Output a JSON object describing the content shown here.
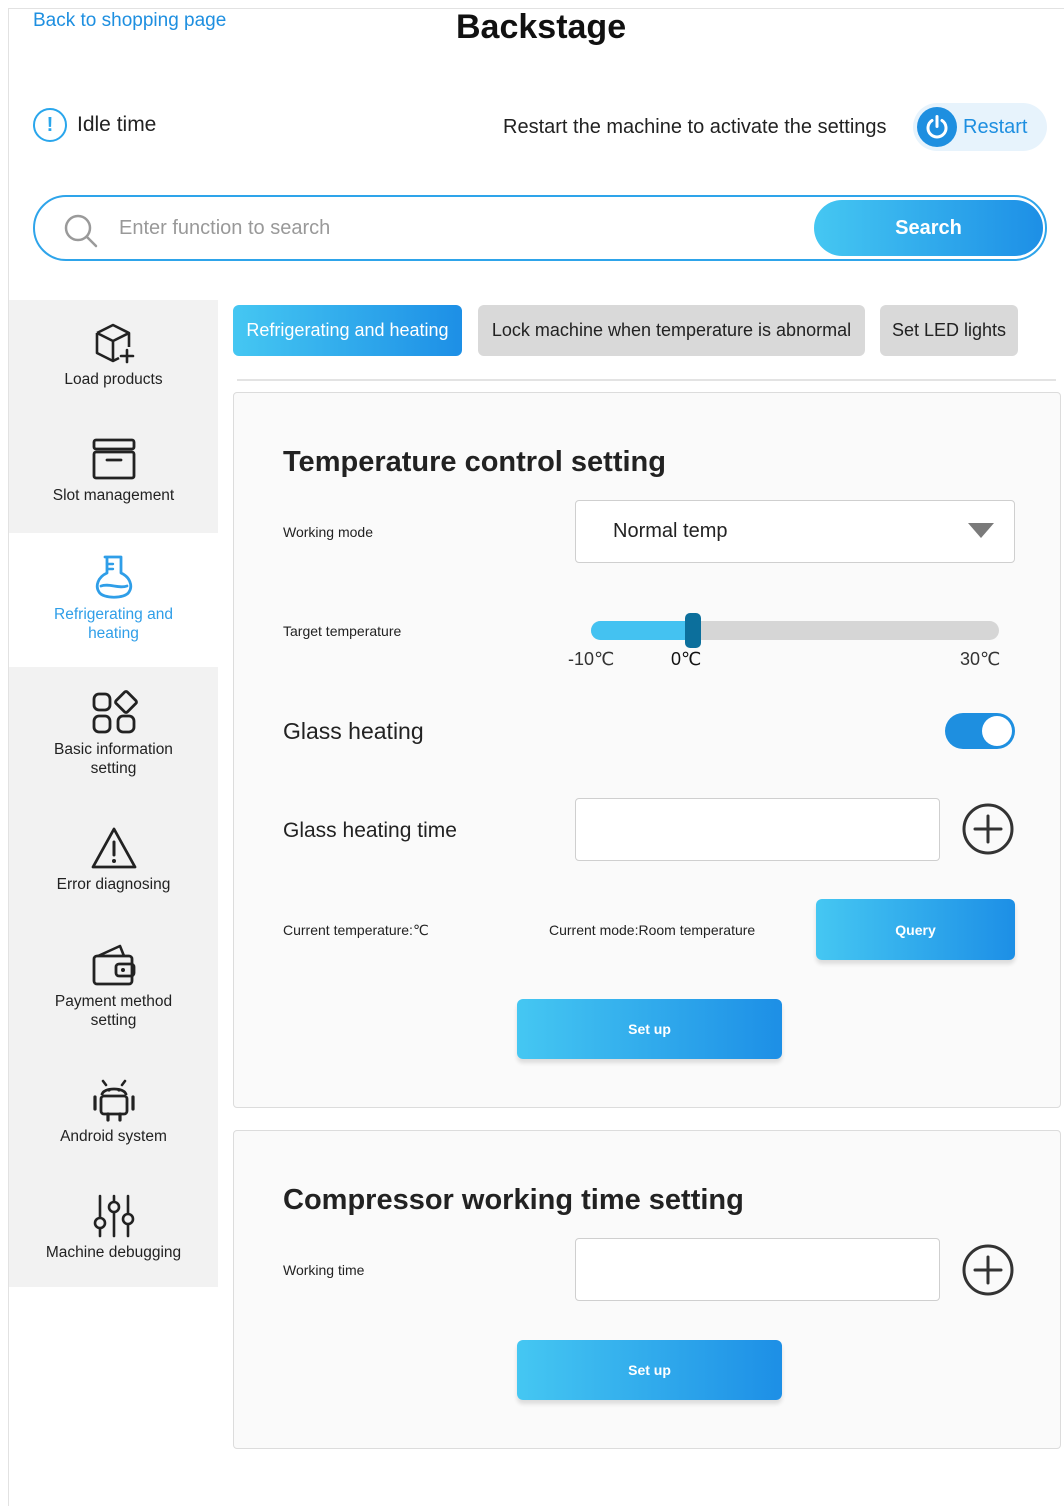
{
  "header": {
    "back_link": "Back to shopping page",
    "title": "Backstage"
  },
  "status": {
    "idle_label": "Idle time",
    "restart_hint": "Restart the machine to activate the settings",
    "restart_label": "Restart"
  },
  "search": {
    "placeholder": "Enter function to search",
    "value": "",
    "button_label": "Search"
  },
  "sidebar": {
    "items": [
      {
        "label": "Load products",
        "icon": "box-plus-icon"
      },
      {
        "label": "Slot management",
        "icon": "archive-icon"
      },
      {
        "label": "Refrigerating and heating",
        "icon": "flask-icon",
        "active": true
      },
      {
        "label": "Basic information setting",
        "icon": "grid-icon"
      },
      {
        "label": "Error diagnosing",
        "icon": "warning-icon"
      },
      {
        "label": "Payment method setting",
        "icon": "wallet-icon"
      },
      {
        "label": "Android system",
        "icon": "android-icon"
      },
      {
        "label": "Machine debugging",
        "icon": "sliders-icon"
      }
    ]
  },
  "tabs": [
    {
      "label": "Refrigerating and heating",
      "active": true
    },
    {
      "label": "Lock machine when temperature is abnormal",
      "active": false
    },
    {
      "label": "Set LED lights",
      "active": false
    }
  ],
  "temperature_card": {
    "title": "Temperature control setting",
    "working_mode_label": "Working mode",
    "working_mode_value": "Normal temp",
    "target_temp_label": "Target temperature",
    "target_temp_min": "-10℃",
    "target_temp_current": "0℃",
    "target_temp_max": "30℃",
    "target_temp_value": 0,
    "target_temp_range": [
      -10,
      30
    ],
    "glass_heating_label": "Glass heating",
    "glass_heating_on": true,
    "glass_heating_time_label": "Glass heating time",
    "glass_heating_time_value": "",
    "current_temp_label": "Current temperature:℃",
    "current_mode_label": "Current mode:Room temperature",
    "query_label": "Query",
    "setup_label": "Set up"
  },
  "compressor_card": {
    "title": "Compressor working time setting",
    "working_time_label": "Working time",
    "working_time_value": "",
    "setup_label": "Set up"
  },
  "colors": {
    "accent": "#1e8fe0",
    "accent_light": "#45c7f2",
    "sidebar_bg": "#f2f2f2",
    "active_text": "#2f9ee8"
  }
}
